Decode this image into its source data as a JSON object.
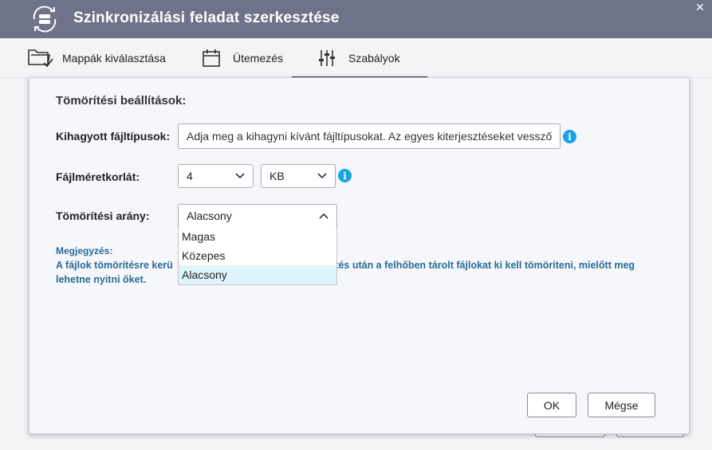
{
  "window": {
    "title": "Szinkronizálási feladat szerkesztése",
    "close_glyph": "✕",
    "app_icon": "sync-drive-icon"
  },
  "tabs": [
    {
      "label": "Mappák kiválasztása",
      "icon": "folder-check-icon",
      "active": false
    },
    {
      "label": "Ütemezés",
      "icon": "calendar-icon",
      "active": false
    },
    {
      "label": "Szabályok",
      "icon": "sliders-icon",
      "active": true
    }
  ],
  "compression": {
    "section_title": "Tömörítési beállítások:",
    "skipped_types": {
      "label": "Kihagyott fájltípusok:",
      "value": "Adja meg a kihagyni kívánt fájltípusokat. Az egyes kiterjesztéseket vessző",
      "info_glyph": "i"
    },
    "size_limit": {
      "label": "Fájlméretkorlát:",
      "value": "4",
      "unit": "KB",
      "info_glyph": "i"
    },
    "ratio": {
      "label": "Tömörítési arány:",
      "value": "Alacsony",
      "options": [
        "Magas",
        "Közepes",
        "Alacsony"
      ],
      "selected_index": 2
    }
  },
  "note": {
    "title": "Megjegyzés:",
    "text_before": "A fájlok tömörítésre kerü",
    "text_after": "ítés után a felhőben tárolt fájlokat ki kell tömöríteni, mielőtt meg",
    "text_line2": "lehetne nyitni őket."
  },
  "buttons": {
    "ok": "OK",
    "cancel": "Mégse"
  },
  "colors": {
    "titlebar": "#6e7389",
    "info": "#1aa3e8",
    "note": "#2a6b94",
    "selected_option": "#dff4fb"
  }
}
